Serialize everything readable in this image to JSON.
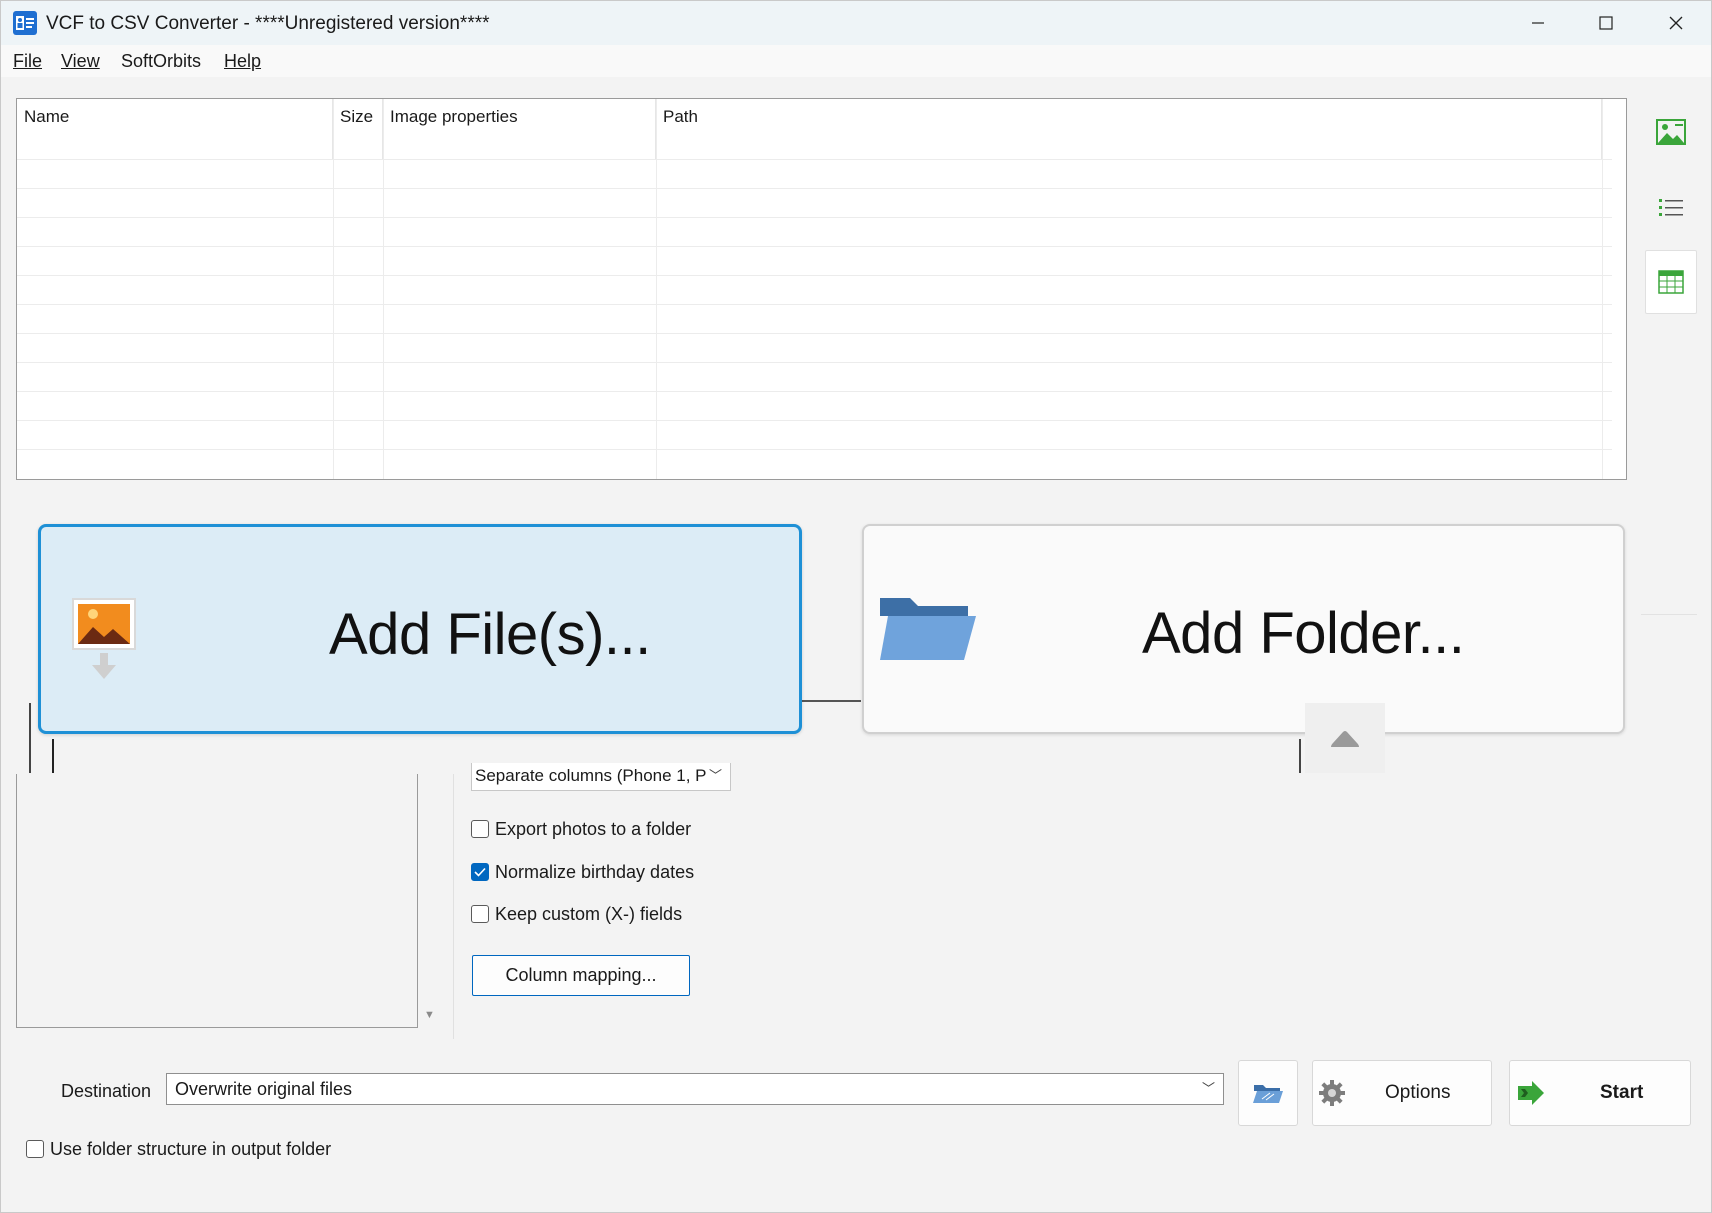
{
  "window": {
    "title": "VCF to CSV Converter - ****Unregistered version****",
    "controls": [
      "minimize-icon",
      "maximize-icon",
      "close-icon"
    ]
  },
  "menu": {
    "items": [
      {
        "label": "File"
      },
      {
        "label": "View"
      },
      {
        "label": "SoftOrbits"
      },
      {
        "label": "Help"
      }
    ]
  },
  "file_list": {
    "columns": [
      "Name",
      "Size",
      "Image properties",
      "Path"
    ],
    "rows": []
  },
  "side_toolbar": {
    "tools": [
      {
        "icon": "thumbnail-view-icon",
        "active": false
      },
      {
        "icon": "list-view-icon",
        "active": false
      },
      {
        "icon": "table-view-icon",
        "active": true
      }
    ]
  },
  "add_buttons": {
    "add_files": "Add File(s)...",
    "add_folder": "Add Folder..."
  },
  "settings": {
    "phone_format_value": "Separate columns (Phone 1, P",
    "checkboxes": [
      {
        "label": "Export photos to a folder",
        "checked": false
      },
      {
        "label": "Normalize birthday dates",
        "checked": true
      },
      {
        "label": "Keep custom (X-) fields",
        "checked": false
      }
    ],
    "column_mapping_button": "Column mapping..."
  },
  "destination": {
    "label": "Destination",
    "value": "Overwrite original files"
  },
  "actions": {
    "options_label": "Options",
    "start_label": "Start"
  },
  "folder_structure": {
    "label": "Use folder structure in output folder",
    "checked": false
  },
  "colors": {
    "accent": "#0067c0",
    "add_files_bg": "#dcecf6",
    "add_files_border": "#1e90d6",
    "start_arrow": "#3aa53a"
  }
}
